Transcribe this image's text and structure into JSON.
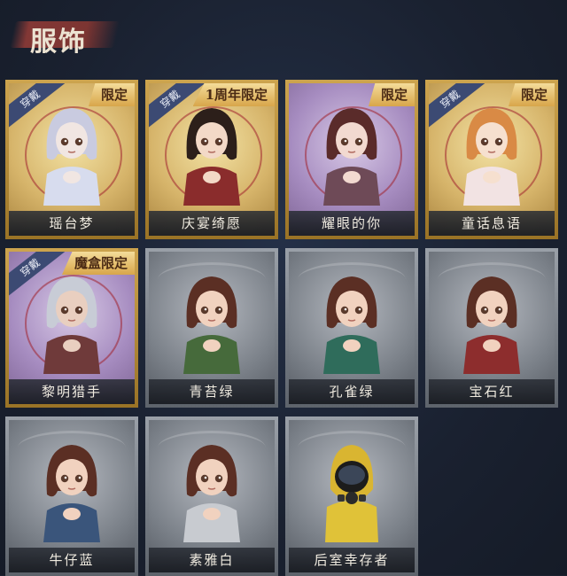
{
  "page": {
    "title": "服饰"
  },
  "cards": [
    {
      "name": "瑶台梦",
      "style": "gold",
      "worn_tag": "穿戴",
      "limited_tag": "限定",
      "hair": "#c9cbe0",
      "skin": "#f1e6e2",
      "cloth": "#d7dcee"
    },
    {
      "name": "庆宴绮愿",
      "style": "gold",
      "worn_tag": "穿戴",
      "limited_tag": "1周年限定",
      "hair": "#2c1f1a",
      "skin": "#f3d9c7",
      "cloth": "#8a2c2c"
    },
    {
      "name": "耀眼的你",
      "style": "gold",
      "worn_tag": "",
      "limited_tag": "限定",
      "hair": "#5a2b2a",
      "skin": "#f2d9d0",
      "cloth": "#6e4a57"
    },
    {
      "name": "童话息语",
      "style": "gold",
      "worn_tag": "穿戴",
      "limited_tag": "限定",
      "hair": "#d98a45",
      "skin": "#f6e0cf",
      "cloth": "#f2e3e3"
    },
    {
      "name": "黎明猎手",
      "style": "gold",
      "worn_tag": "穿戴",
      "limited_tag": "魔盒限定",
      "hair": "#c8ccd6",
      "skin": "#e9cfc0",
      "cloth": "#6f3a3a"
    },
    {
      "name": "青苔绿",
      "style": "silver",
      "worn_tag": "",
      "limited_tag": "",
      "hair": "#5b2f24",
      "skin": "#f1d2bf",
      "cloth": "#466a3b"
    },
    {
      "name": "孔雀绿",
      "style": "silver",
      "worn_tag": "",
      "limited_tag": "",
      "hair": "#5b2f24",
      "skin": "#f1d2bf",
      "cloth": "#2f6c5b"
    },
    {
      "name": "宝石红",
      "style": "silver",
      "worn_tag": "",
      "limited_tag": "",
      "hair": "#5b2f24",
      "skin": "#f1d2bf",
      "cloth": "#8d2d2d"
    },
    {
      "name": "牛仔蓝",
      "style": "silver",
      "worn_tag": "",
      "limited_tag": "",
      "hair": "#5b2f24",
      "skin": "#f1d2bf",
      "cloth": "#3a557b"
    },
    {
      "name": "素雅白",
      "style": "silver",
      "worn_tag": "",
      "limited_tag": "",
      "hair": "#5b2f24",
      "skin": "#f1d2bf",
      "cloth": "#c8cbd0"
    },
    {
      "name": "后室幸存者",
      "style": "silver",
      "worn_tag": "",
      "limited_tag": "",
      "hair": "#d9b531",
      "skin": "#1c1c1c",
      "cloth": "#e0c238"
    }
  ]
}
